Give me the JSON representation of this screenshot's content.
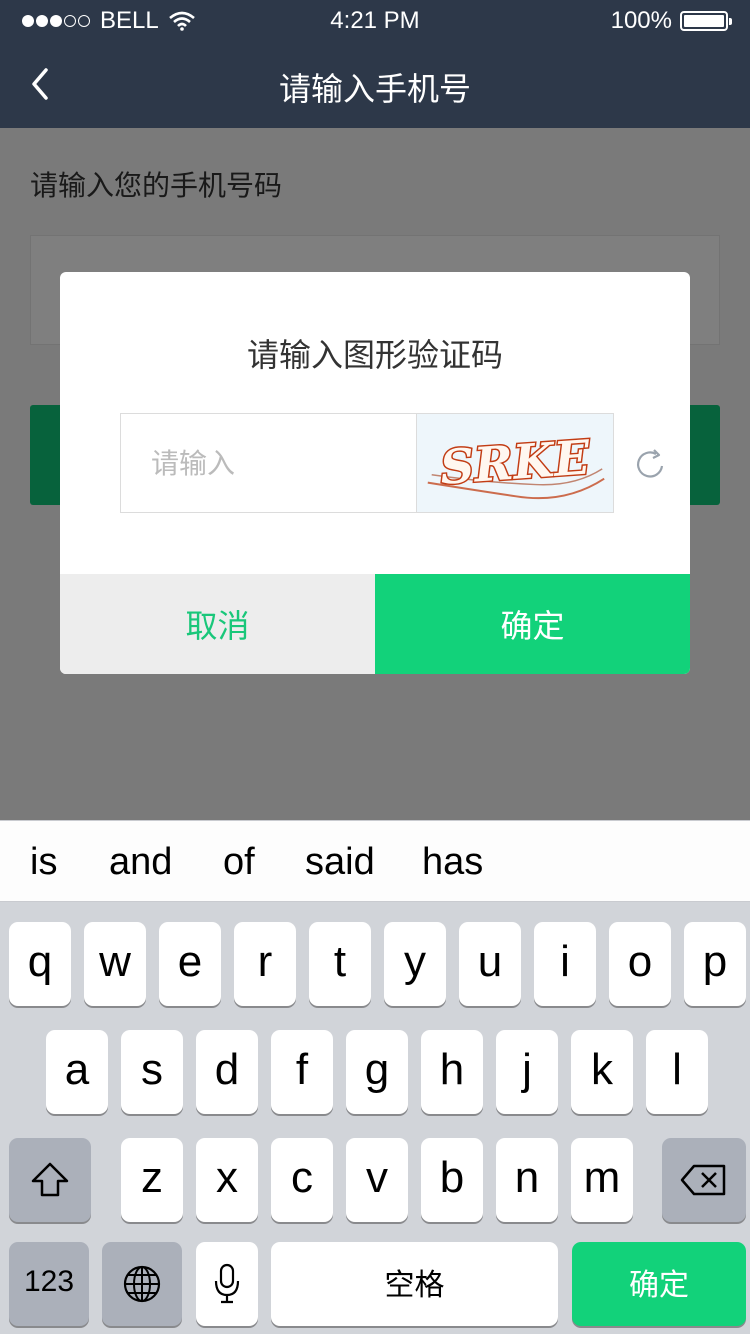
{
  "status_bar": {
    "carrier": "BELL",
    "signal_dots_filled": 3,
    "signal_dots_total": 5,
    "time": "4:21 PM",
    "battery": "100%",
    "battery_level": 1.0
  },
  "navbar": {
    "title": "请输入手机号",
    "back_icon": "chevron-left-icon"
  },
  "page": {
    "hint": "请输入您的手机号码"
  },
  "dialog": {
    "title": "请输入图形验证码",
    "input_placeholder": "请输入",
    "captcha_text": "SRKE",
    "refresh_icon": "refresh-icon",
    "cancel_label": "取消",
    "ok_label": "确定"
  },
  "keyboard": {
    "suggestions": [
      "is",
      "and",
      "of",
      "said",
      "has"
    ],
    "row1": [
      "q",
      "w",
      "e",
      "r",
      "t",
      "y",
      "u",
      "i",
      "o",
      "p"
    ],
    "row2": [
      "a",
      "s",
      "d",
      "f",
      "g",
      "h",
      "j",
      "k",
      "l"
    ],
    "row3": [
      "z",
      "x",
      "c",
      "v",
      "b",
      "n",
      "m"
    ],
    "numbers_label": "123",
    "space_label": "空格",
    "return_label": "确定",
    "shift_icon": "shift-icon",
    "delete_icon": "delete-icon",
    "globe_icon": "globe-icon",
    "mic_icon": "microphone-icon"
  },
  "colors": {
    "nav_bg": "#2d3849",
    "accent_green": "#12d27a",
    "keyboard_bg": "#d1d4d9"
  }
}
